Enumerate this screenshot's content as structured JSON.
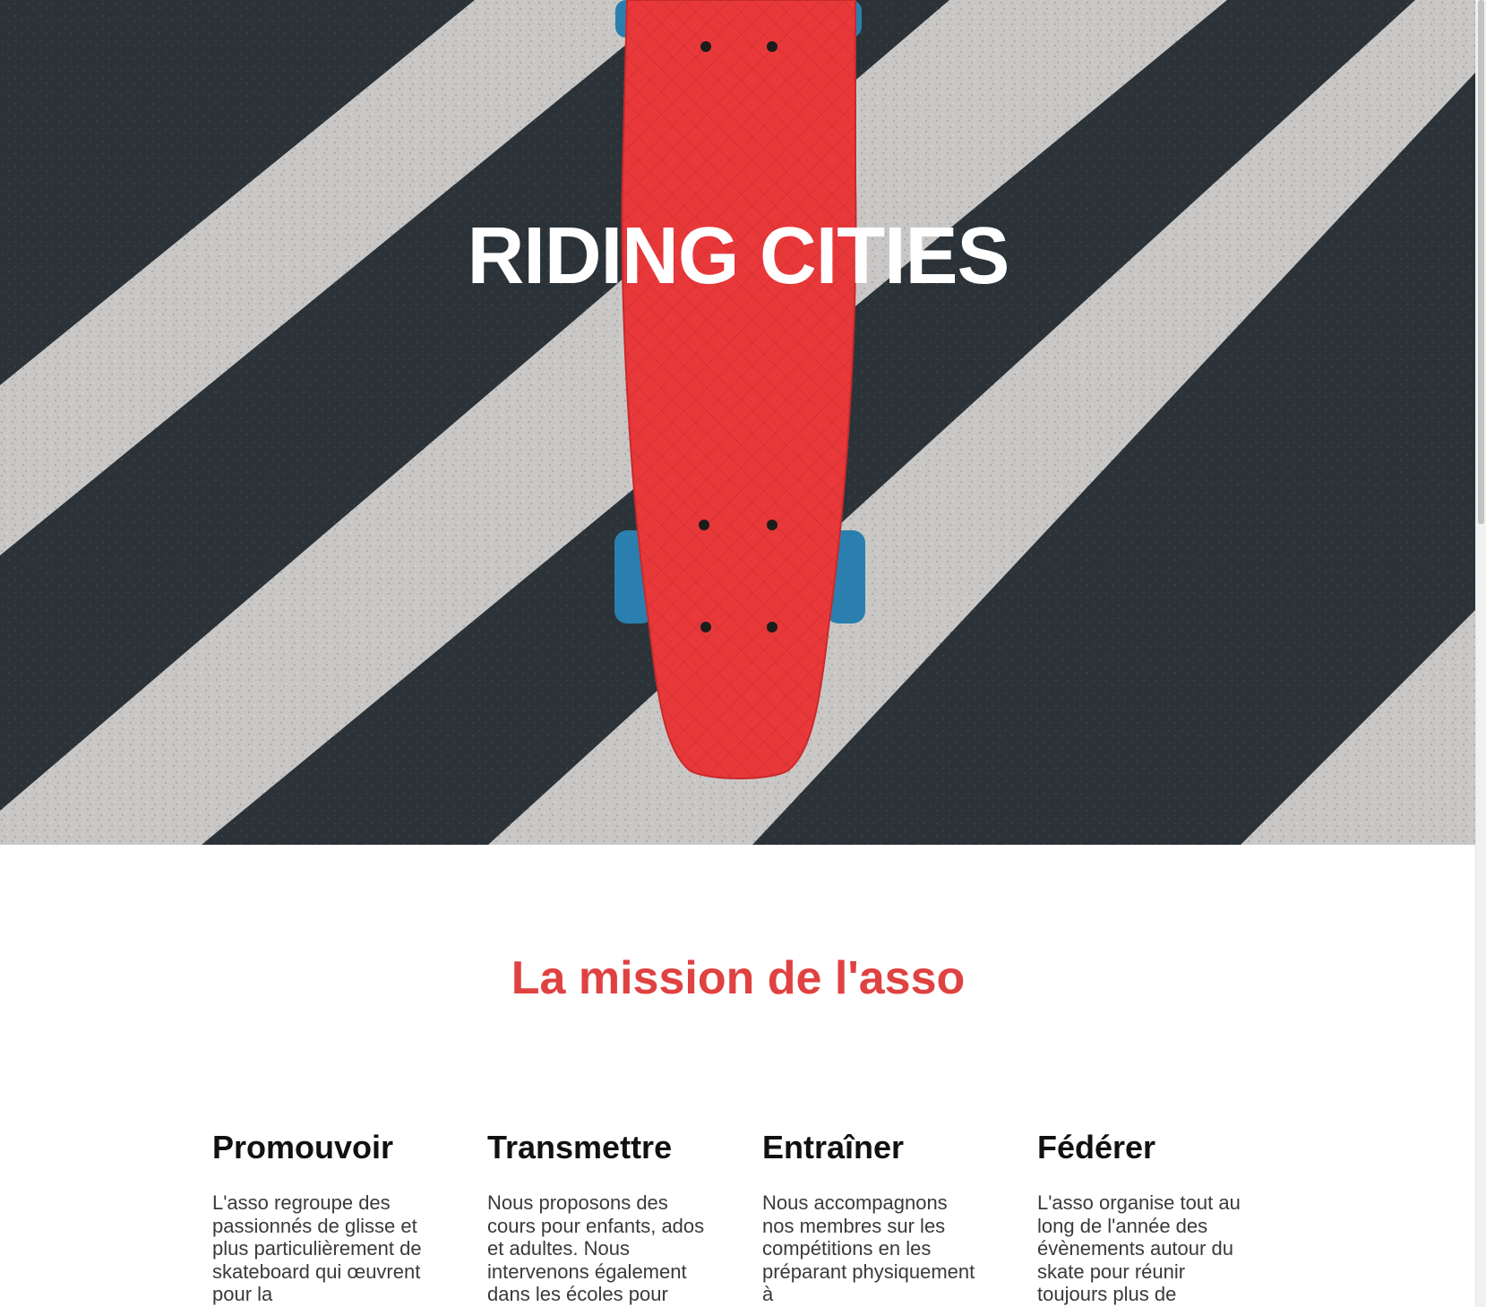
{
  "hero": {
    "title": "RIDING CITIES"
  },
  "mission": {
    "title": "La mission de l'asso",
    "columns": [
      {
        "title": "Promouvoir",
        "text": "L'asso regroupe des passionnés de glisse et plus particulièrement de skateboard qui œuvrent pour la"
      },
      {
        "title": "Transmettre",
        "text": "Nous proposons des cours pour enfants, ados et adultes. Nous intervenons également dans les écoles pour"
      },
      {
        "title": "Entraîner",
        "text": "Nous accompagnons nos membres sur les compétitions en les préparant physiquement à"
      },
      {
        "title": "Fédérer",
        "text": "L'asso organise tout au long de l'année des évènements autour du skate pour réunir toujours plus de"
      }
    ]
  },
  "colors": {
    "accent": "#e04141",
    "skateboard": "#e8383a",
    "wheels": "#2a7fae",
    "asphalt": "#2b3339",
    "stripes": "#c9c7c5"
  }
}
